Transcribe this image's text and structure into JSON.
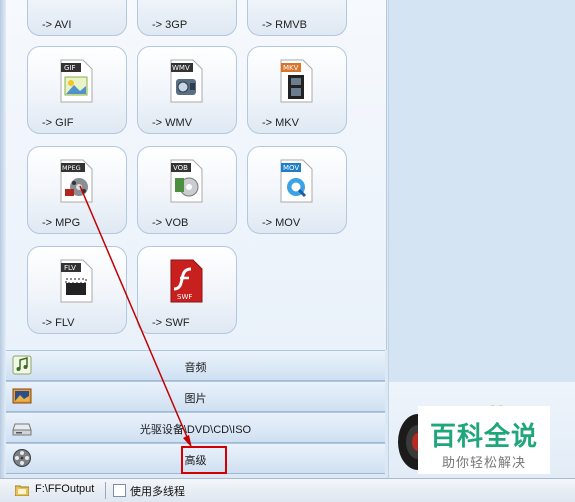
{
  "formats": {
    "row0": [
      "-> AVI",
      "-> 3GP",
      "-> RMVB"
    ],
    "row1": [
      "-> GIF",
      "-> WMV",
      "-> MKV"
    ],
    "row2": [
      "-> MPG",
      "-> VOB",
      "-> MOV"
    ],
    "row3": [
      "-> FLV",
      "-> SWF"
    ]
  },
  "badges": {
    "gif": "GIF",
    "wmv": "WMV",
    "mkv": "MKV",
    "mpeg": "MPEG",
    "vob": "VOB",
    "mov": "MOV",
    "flv": "FLV",
    "swf": "SWF"
  },
  "categories": {
    "audio": "音频",
    "image": "图片",
    "rom": "光驱设备\\DVD\\CD\\ISO",
    "advanced": "高级"
  },
  "status": {
    "output_path": "F:\\FFOutput",
    "multithread_label": "使用多线程"
  },
  "watermark": {
    "title": "百科全说",
    "subtitle": "助你轻松解决"
  },
  "colors": {
    "annotation": "#d40000",
    "watermark_green": "#1fa67a"
  }
}
